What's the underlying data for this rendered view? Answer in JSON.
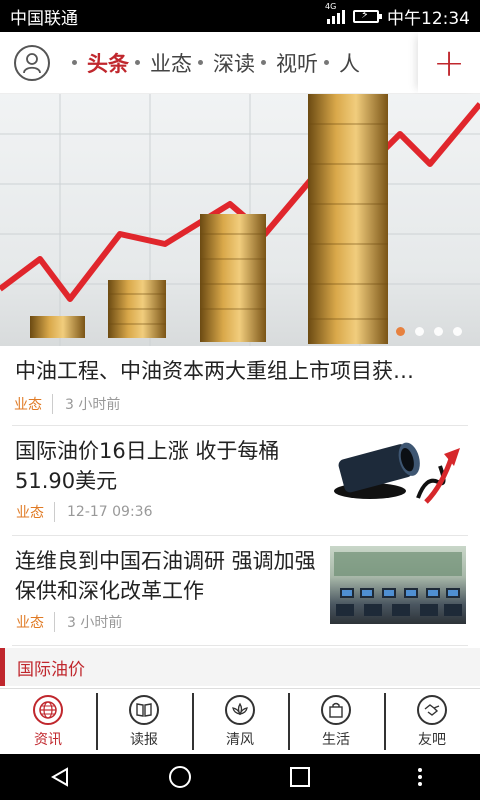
{
  "status": {
    "carrier": "中国联通",
    "network": "4G",
    "time": "中午12:34"
  },
  "topnav": {
    "tabs": [
      {
        "label": "头条",
        "active": true
      },
      {
        "label": "业态",
        "active": false
      },
      {
        "label": "深读",
        "active": false
      },
      {
        "label": "视听",
        "active": false
      },
      {
        "label": "人",
        "active": false
      }
    ],
    "add_label": "+"
  },
  "banner": {
    "pages": 4,
    "current": 1
  },
  "news": [
    {
      "title": "中油工程、中油资本两大重组上市项目获…",
      "category": "业态",
      "time": "3 小时前"
    },
    {
      "title": "国际油价16日上涨 收于每桶51.90美元",
      "category": "业态",
      "time": "12-17 09:36"
    },
    {
      "title": "连维良到中国石油调研 强调加强保供和深化改革工作",
      "category": "业态",
      "time": "3 小时前"
    }
  ],
  "section": {
    "title": "国际油价"
  },
  "tabbar": [
    {
      "label": "资讯",
      "icon": "globe-icon",
      "active": true
    },
    {
      "label": "读报",
      "icon": "book-icon",
      "active": false
    },
    {
      "label": "清风",
      "icon": "lotus-icon",
      "active": false
    },
    {
      "label": "生活",
      "icon": "bag-icon",
      "active": false
    },
    {
      "label": "友吧",
      "icon": "handshake-icon",
      "active": false
    }
  ],
  "colors": {
    "accent": "#c0272d",
    "category": "#e07a24"
  }
}
